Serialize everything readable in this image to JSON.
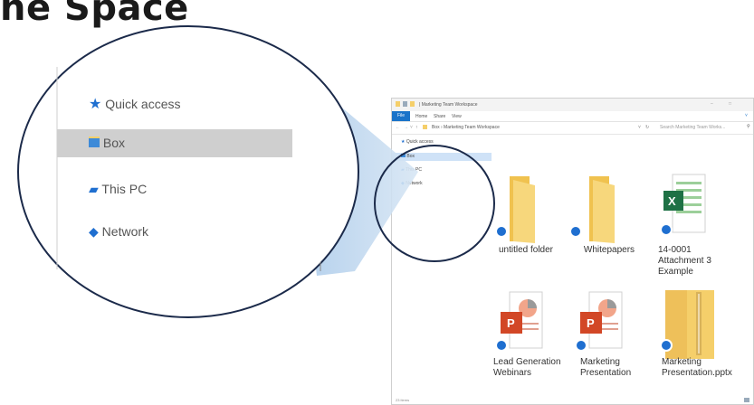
{
  "slide": {
    "title": "ne Space"
  },
  "window": {
    "title": "| Marketing Team Workspace",
    "ribbon_tabs": [
      "File",
      "Home",
      "Share",
      "View"
    ],
    "address": "Box › Marketing Team Workspace",
    "search_placeholder": "Search Marketing Team Works...",
    "status": "23 items"
  },
  "sidebar": {
    "items": [
      {
        "label": "Quick access",
        "icon": "star-icon"
      },
      {
        "label": "Box",
        "icon": "box-folder-icon"
      },
      {
        "label": "This PC",
        "icon": "pc-icon"
      },
      {
        "label": "Network",
        "icon": "network-icon"
      }
    ]
  },
  "files": [
    {
      "label": "untitled folder",
      "type": "folder"
    },
    {
      "label": "Whitepapers",
      "type": "folder"
    },
    {
      "label": "14-0001 Attachment 3 Example",
      "type": "excel",
      "icon_letter": "X"
    },
    {
      "label": "Lead Generation Webinars",
      "type": "powerpoint",
      "icon_letter": "P"
    },
    {
      "label": "Marketing Presentation",
      "type": "powerpoint",
      "icon_letter": "P"
    },
    {
      "label": "Marketing Presentation.pptx",
      "type": "zip"
    }
  ],
  "colors": {
    "accent": "#1a73c9",
    "folder": "#f5cf6a",
    "excel": "#1e7145",
    "powerpoint": "#d24726",
    "sync_badge": "#1f6fd0",
    "callout_border": "#1b2a4a"
  }
}
